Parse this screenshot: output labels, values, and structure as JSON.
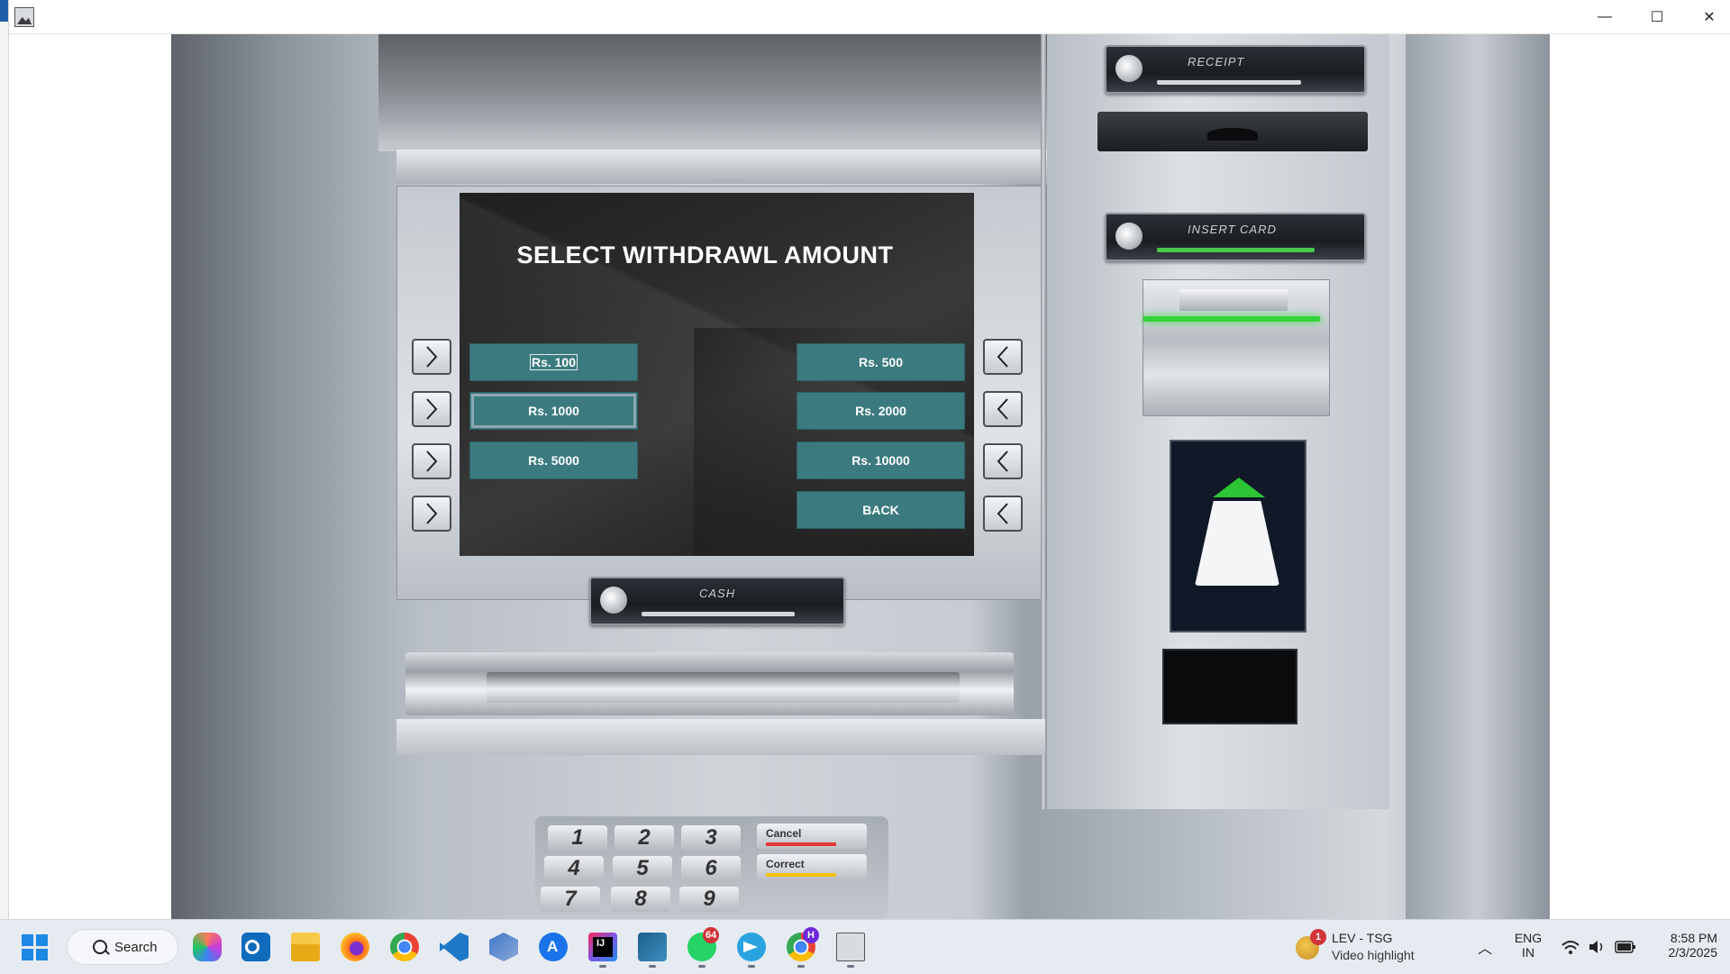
{
  "window": {
    "minimize_glyph": "—",
    "maximize_glyph": "☐",
    "close_glyph": "✕"
  },
  "atm": {
    "screen_title": "SELECT WITHDRAWL AMOUNT",
    "options_left": [
      "Rs. 100",
      "Rs. 1000",
      "Rs. 5000"
    ],
    "options_right": [
      "Rs. 500",
      "Rs. 2000",
      "Rs. 10000"
    ],
    "back_label": "BACK",
    "receipt_label": "RECEIPT",
    "card_label": "INSERT CARD",
    "cash_label": "CASH",
    "keypad_keys": [
      "1",
      "2",
      "3",
      "4",
      "5",
      "6",
      "7",
      "8",
      "9"
    ],
    "cancel_label": "Cancel",
    "correct_label": "Correct",
    "accent_color": "#3b7b7f"
  },
  "taskbar": {
    "search_label": "Search",
    "pinned_icons": [
      "copilot-icon",
      "outlook-icon",
      "file-explorer-icon",
      "firefox-icon",
      "chrome-icon",
      "vscode-icon",
      "virtualbox-icon",
      "app-store-icon",
      "intellij-icon",
      "mysql-workbench-icon",
      "whatsapp-icon",
      "telegram-icon",
      "chrome-profile-icon",
      "java-app-icon"
    ],
    "whatsapp_badge": "64",
    "chrome_profile_badge": "H",
    "weather_badge": "1",
    "weather_title": "LEV - TSG",
    "weather_subtitle": "Video highlight",
    "language_line1": "ENG",
    "language_line2": "IN",
    "time": "8:58 PM",
    "date": "2/3/2025"
  }
}
